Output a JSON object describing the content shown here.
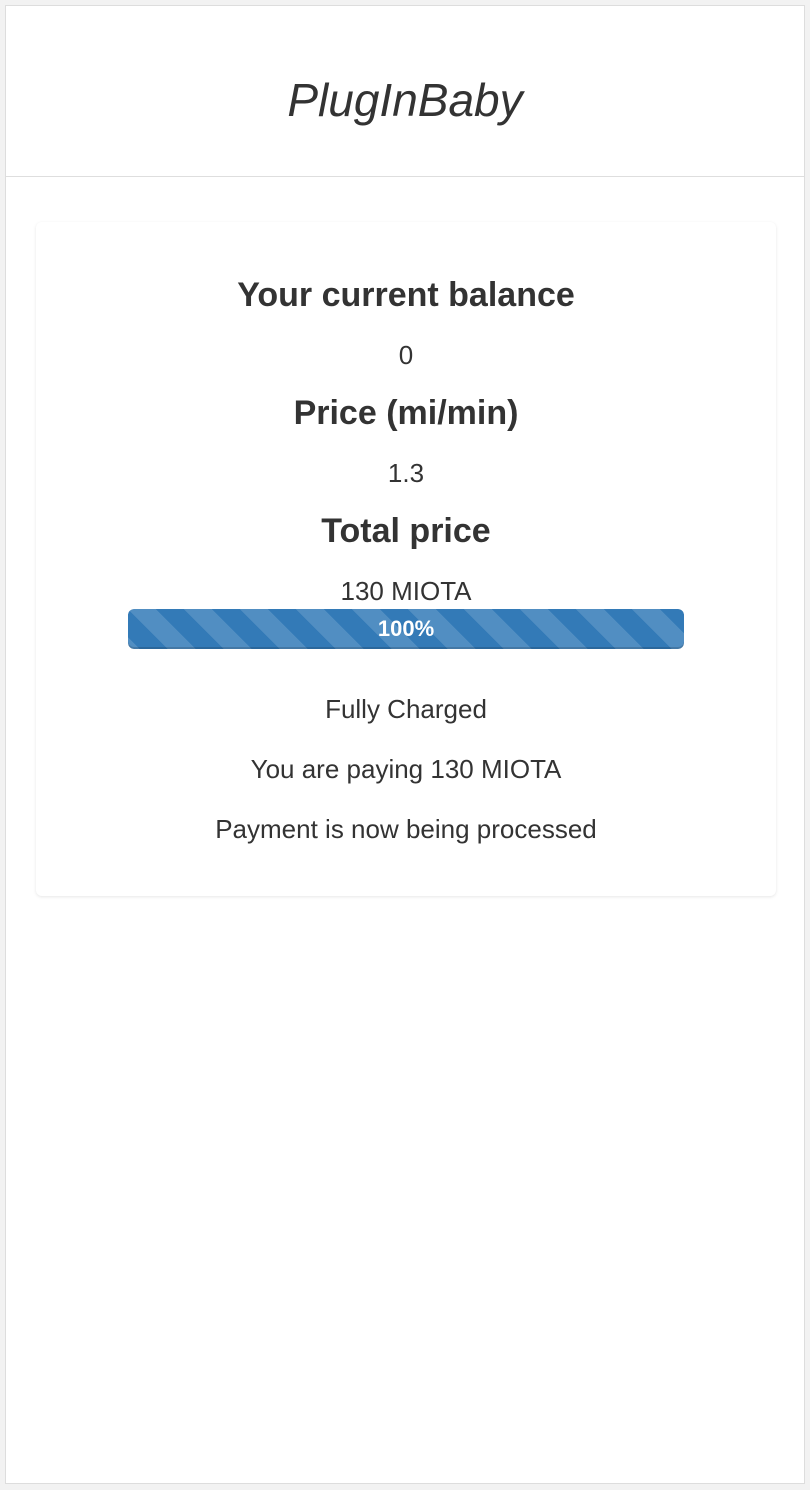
{
  "app": {
    "title": "PlugInBaby"
  },
  "balance": {
    "label": "Your current balance",
    "value": "0"
  },
  "price": {
    "label": "Price (mi/min)",
    "value": "1.3"
  },
  "total": {
    "label": "Total price",
    "value": "130 MIOTA"
  },
  "progress": {
    "percent": 100,
    "label": "100%"
  },
  "status": {
    "charged": "Fully Charged",
    "paying": "You are paying 130 MIOTA",
    "processing": "Payment is now being processed"
  },
  "colors": {
    "progress_bar": "#337ab7",
    "text": "#333333"
  }
}
